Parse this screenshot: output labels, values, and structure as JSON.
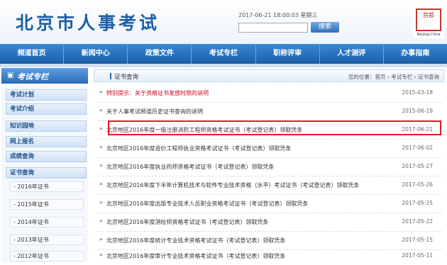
{
  "header": {
    "site_title": "北京市人事考试",
    "datetime": "2017-06-21 18:00:03 星期三",
    "search_placeholder": "",
    "search_button": "搜索",
    "logo_chars": "首都",
    "logo_en": "Beijing-China"
  },
  "nav": [
    "频道首页",
    "新闻中心",
    "政策文件",
    "考试专栏",
    "职称评审",
    "人才测评",
    "办事指南"
  ],
  "sidebar": {
    "title": "考试专栏",
    "items": [
      "考试计划",
      "考试介绍",
      "知识园地",
      "网上报名",
      "成绩查询",
      "证书查询"
    ],
    "sub_items": [
      "- 2016年证书",
      "- 2015年证书",
      "- 2014年证书",
      "- 2013年证书",
      "- 2012年证书"
    ]
  },
  "main": {
    "title": "证书查询",
    "breadcrumb": "您的位置：首页 › 考试专栏 › 证书查询",
    "rows": [
      {
        "text": "特别提示：关于资格证书发放时限的说明",
        "date": "2015-03-18"
      },
      {
        "text": "关于人事考试频道历史证书查询的说明",
        "date": "2015-06-19"
      },
      {
        "text": "北京地区2016年度一级注册消防工程师资格考试证书（考试登记表）领取凭条",
        "date": "2017-06-21"
      },
      {
        "text": "北京地区2016年度造价工程师执业资格考试证书（考试登记表）领取凭条",
        "date": "2017-06-02"
      },
      {
        "text": "北京地区2016年度执业药师资格考试证书（考试登记表）领取凭条",
        "date": "2017-05-27"
      },
      {
        "text": "北京地区2016年度下半年计算机技术与软件专业技术资格（水平）考试证书（考试登记表）领取凭条",
        "date": "2017-05-26"
      },
      {
        "text": "北京地区2016年度出版专业技术人员职业资格考试证书（考试登记表）领取凭条",
        "date": "2017-05-25"
      },
      {
        "text": "北京地区2016年度测绘师资格考试证书（考试登记表）领取凭条",
        "date": "2017-05-22"
      },
      {
        "text": "北京地区2016年度统计专业技术资格考试证书（考试登记表）领取凭条",
        "date": "2017-05-15"
      },
      {
        "text": "北京地区2016年度审计专业技术资格考试证书（考试登记表）领取凭条",
        "date": "2017-05-11"
      }
    ]
  },
  "colors": {
    "accent": "#1b5ea8",
    "alert": "#d0021b",
    "highlight_border": "#e11b22"
  }
}
